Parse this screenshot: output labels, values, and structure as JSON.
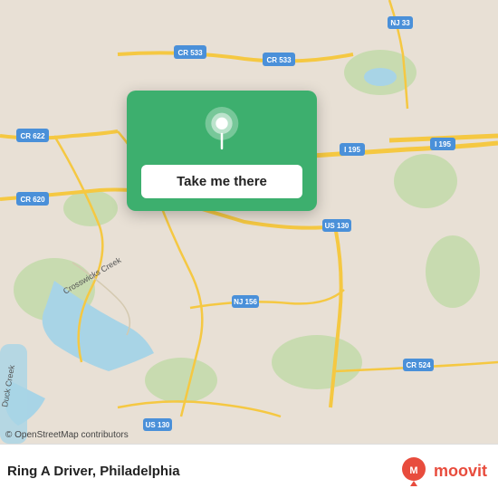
{
  "map": {
    "attribution": "© OpenStreetMap contributors"
  },
  "card": {
    "button_label": "Take me there"
  },
  "bottom_bar": {
    "app_name": "Ring A Driver, Philadelphia",
    "moovit_label": "moovit"
  }
}
